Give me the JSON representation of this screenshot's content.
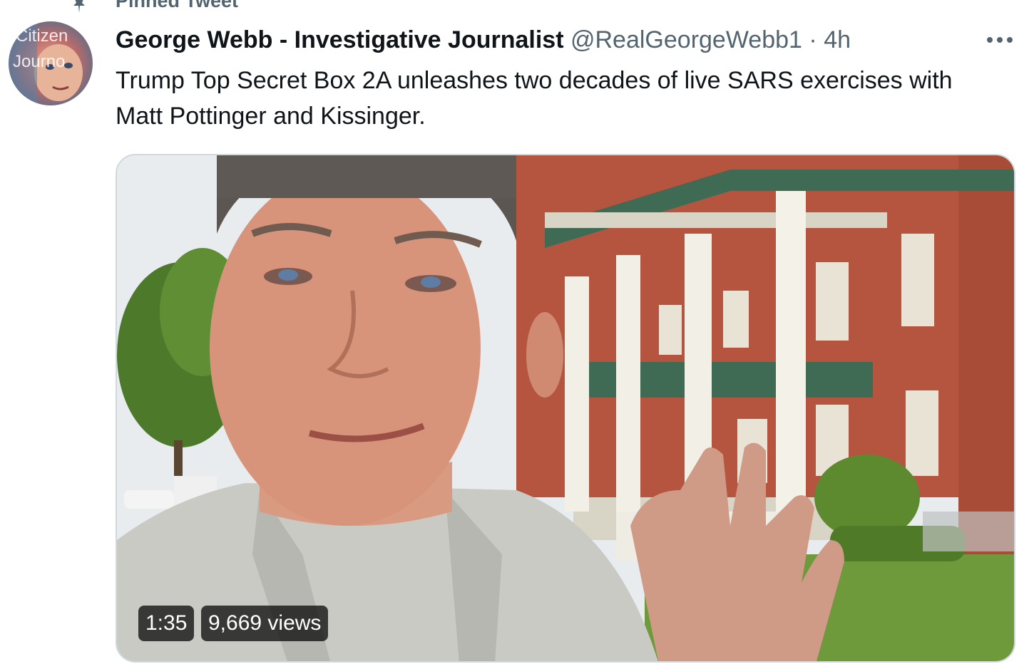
{
  "pinned": {
    "label": "Pinned Tweet",
    "icon": "pin-icon"
  },
  "tweet": {
    "author": {
      "display_name": "George Webb - Investigative Journalist",
      "handle": "@RealGeorgeWebb1",
      "separator": "·",
      "time": "4h",
      "avatar_text": [
        "Citizen",
        "Journo"
      ]
    },
    "text": "Trump Top Secret Box 2A unleashes two decades of live SARS exercises with Matt Pottinger and Kissinger.",
    "more_icon": "more-horizontal-icon",
    "media": {
      "type": "video",
      "duration": "1:35",
      "views": "9,669 views"
    }
  },
  "colors": {
    "text_primary": "#0f1419",
    "text_secondary": "#536471",
    "border": "#cfd9de",
    "badge_bg": "rgba(0,0,0,0.72)"
  }
}
